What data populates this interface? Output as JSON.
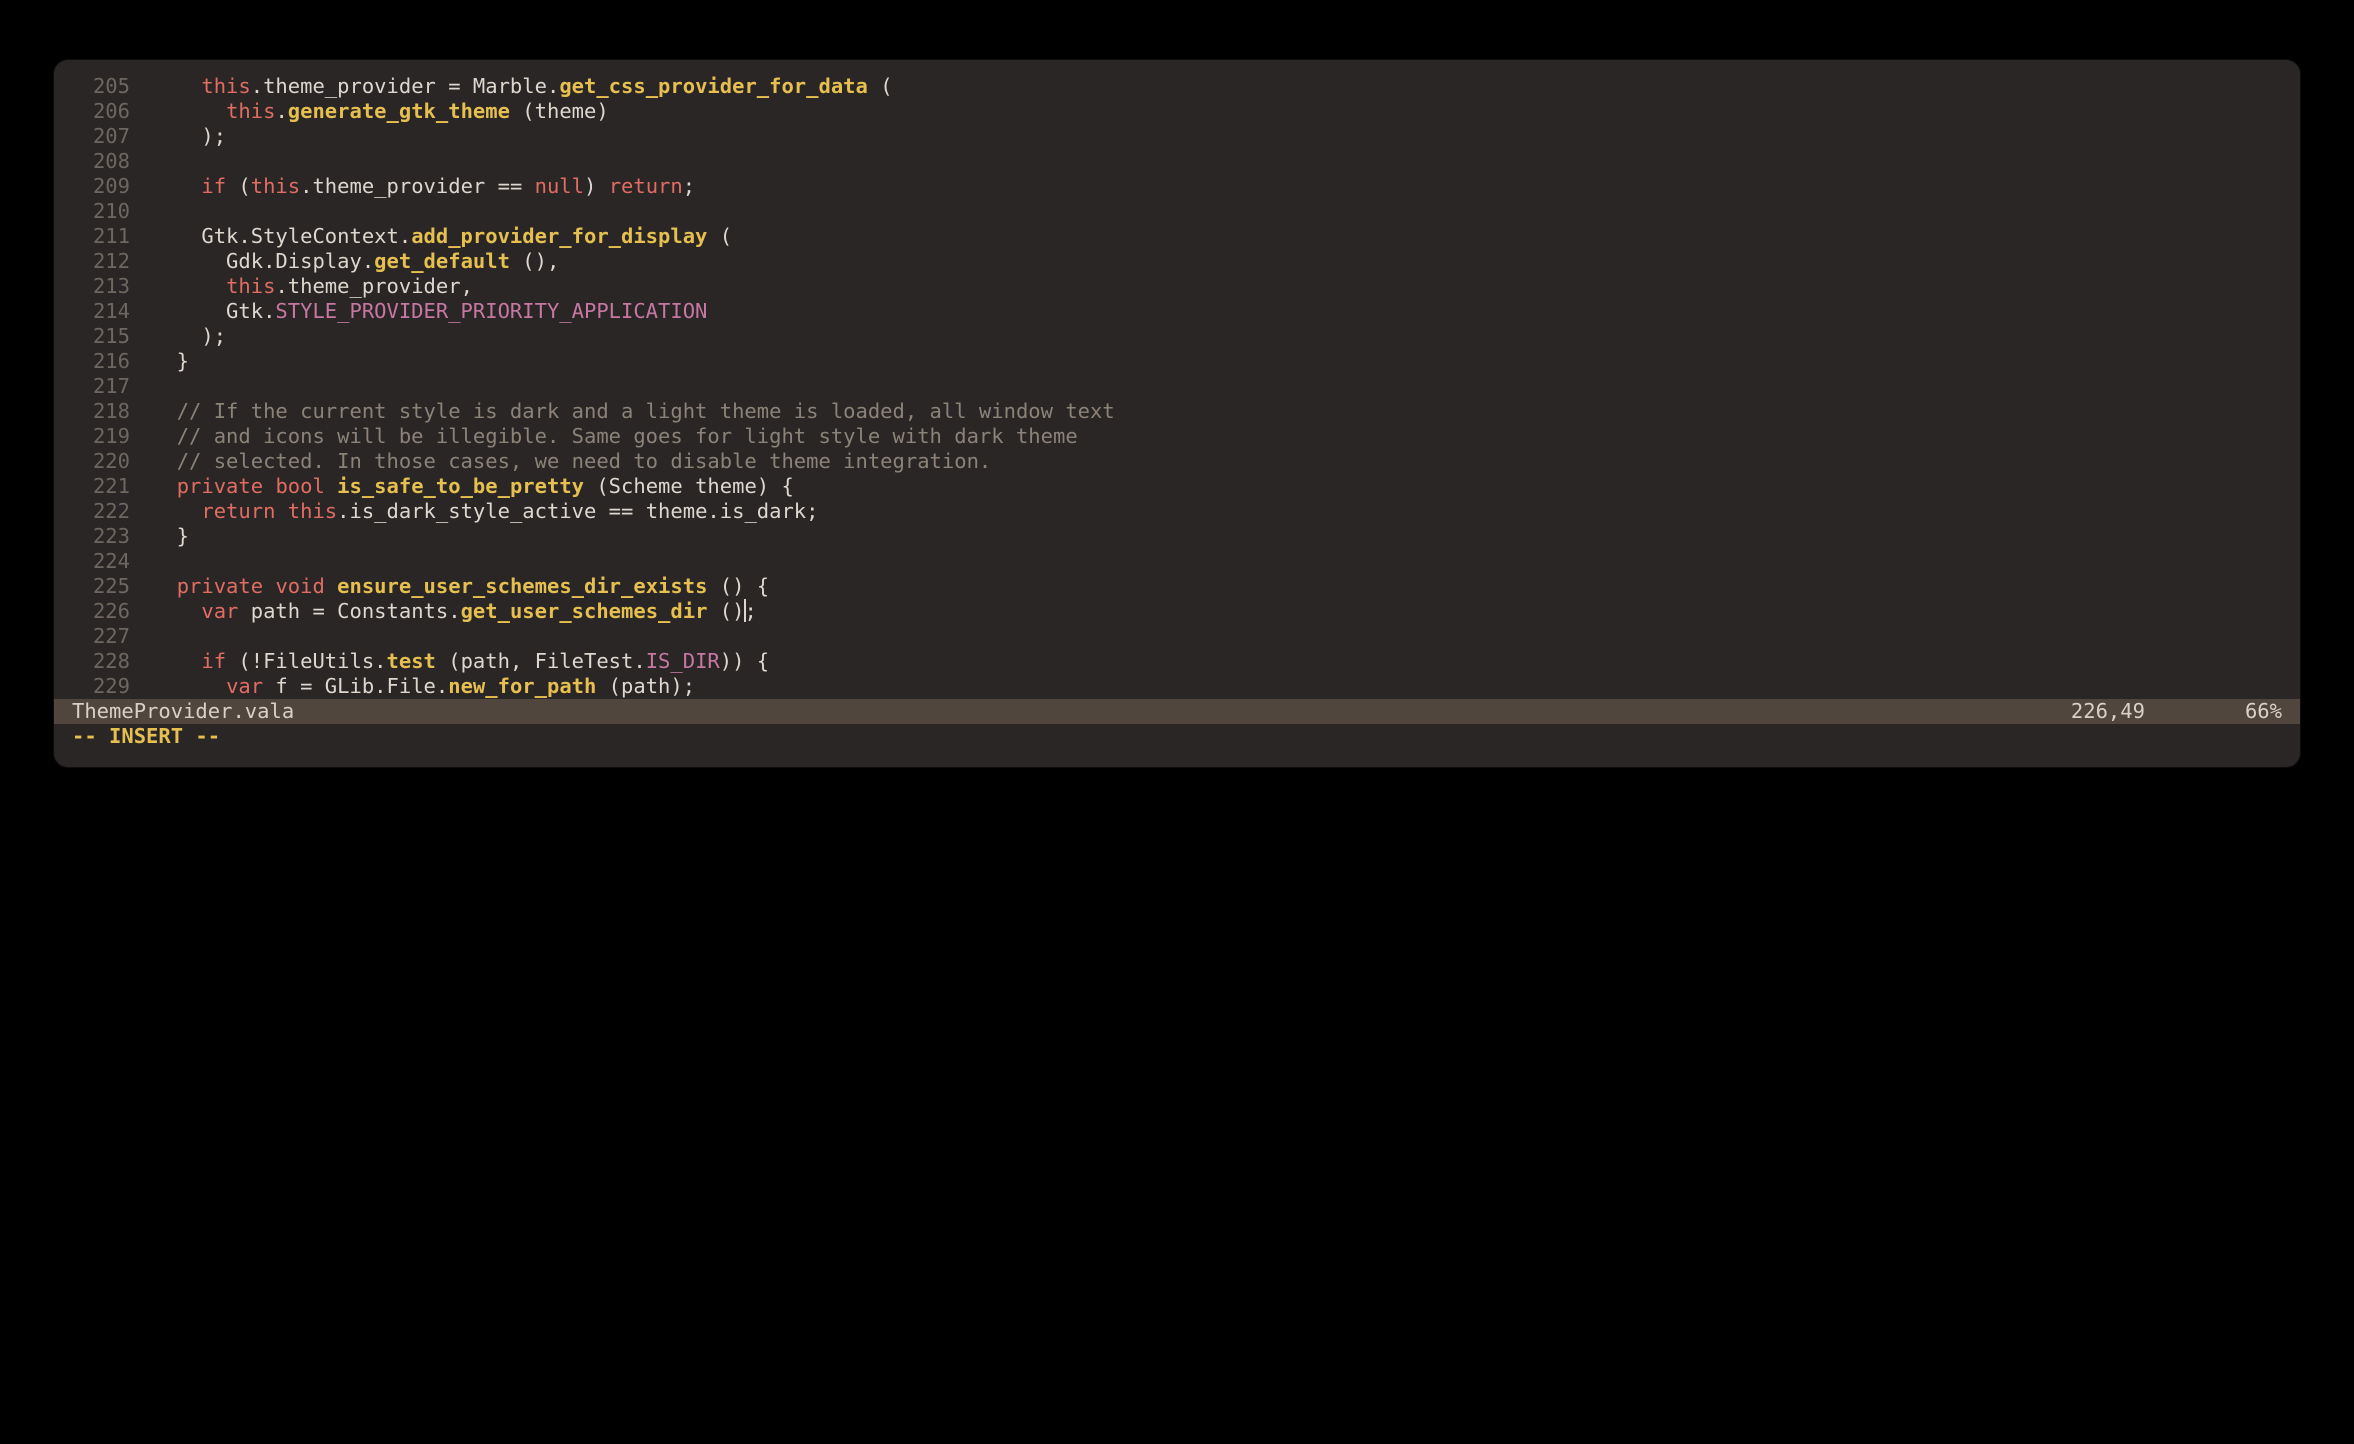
{
  "status": {
    "file": "ThemeProvider.vala",
    "position": "226,49",
    "percent": "66%"
  },
  "mode": "-- INSERT --",
  "first_line_number": 205,
  "cursor": {
    "line_index": 21,
    "after_html_index": 1
  },
  "lines": [
    [
      "    ",
      [
        "kw",
        "this"
      ],
      ".theme_provider = Marble.",
      [
        "fn",
        "get_css_provider_for_data"
      ],
      " ("
    ],
    [
      "      ",
      [
        "kw",
        "this"
      ],
      ".",
      [
        "fn",
        "generate_gtk_theme"
      ],
      " (theme)"
    ],
    [
      "    );"
    ],
    [
      ""
    ],
    [
      "    ",
      [
        "kw",
        "if"
      ],
      " (",
      [
        "kw",
        "this"
      ],
      ".theme_provider == ",
      [
        "kw",
        "null"
      ],
      ") ",
      [
        "kw",
        "return"
      ],
      ";"
    ],
    [
      ""
    ],
    [
      "    Gtk.StyleContext.",
      [
        "fn",
        "add_provider_for_display"
      ],
      " ("
    ],
    [
      "      Gdk.Display.",
      [
        "fn",
        "get_default"
      ],
      " (),"
    ],
    [
      "      ",
      [
        "kw",
        "this"
      ],
      ".theme_provider,"
    ],
    [
      "      Gtk.",
      [
        "const",
        "STYLE_PROVIDER_PRIORITY_APPLICATION"
      ]
    ],
    [
      "    );"
    ],
    [
      "  }"
    ],
    [
      ""
    ],
    [
      "  ",
      [
        "cmt",
        "// If the current style is dark and a light theme is loaded, all window text"
      ]
    ],
    [
      "  ",
      [
        "cmt",
        "// and icons will be illegible. Same goes for light style with dark theme"
      ]
    ],
    [
      "  ",
      [
        "cmt",
        "// selected. In those cases, we need to disable theme integration."
      ]
    ],
    [
      "  ",
      [
        "kw",
        "private"
      ],
      " ",
      [
        "kw",
        "bool"
      ],
      " ",
      [
        "fn",
        "is_safe_to_be_pretty"
      ],
      " (Scheme theme) {"
    ],
    [
      "    ",
      [
        "kw",
        "return"
      ],
      " ",
      [
        "kw",
        "this"
      ],
      ".is_dark_style_active == theme.is_dark;"
    ],
    [
      "  }"
    ],
    [
      ""
    ],
    [
      "  ",
      [
        "kw",
        "private"
      ],
      " ",
      [
        "kw",
        "void"
      ],
      " ",
      [
        "fn",
        "ensure_user_schemes_dir_exists"
      ],
      " () {"
    ],
    [
      "    ",
      [
        "kw",
        "var"
      ],
      " path = Constants.",
      [
        "fn",
        "get_user_schemes_dir"
      ],
      " ()",
      [
        "CURSOR"
      ],
      ";"
    ],
    [
      ""
    ],
    [
      "    ",
      [
        "kw",
        "if"
      ],
      " (!FileUtils.",
      [
        "fn",
        "test"
      ],
      " (path, FileTest.",
      [
        "const",
        "IS_DIR"
      ],
      ")) {"
    ],
    [
      "      ",
      [
        "kw",
        "var"
      ],
      " f = GLib.File.",
      [
        "fn",
        "new_for_path"
      ],
      " (path);"
    ]
  ]
}
